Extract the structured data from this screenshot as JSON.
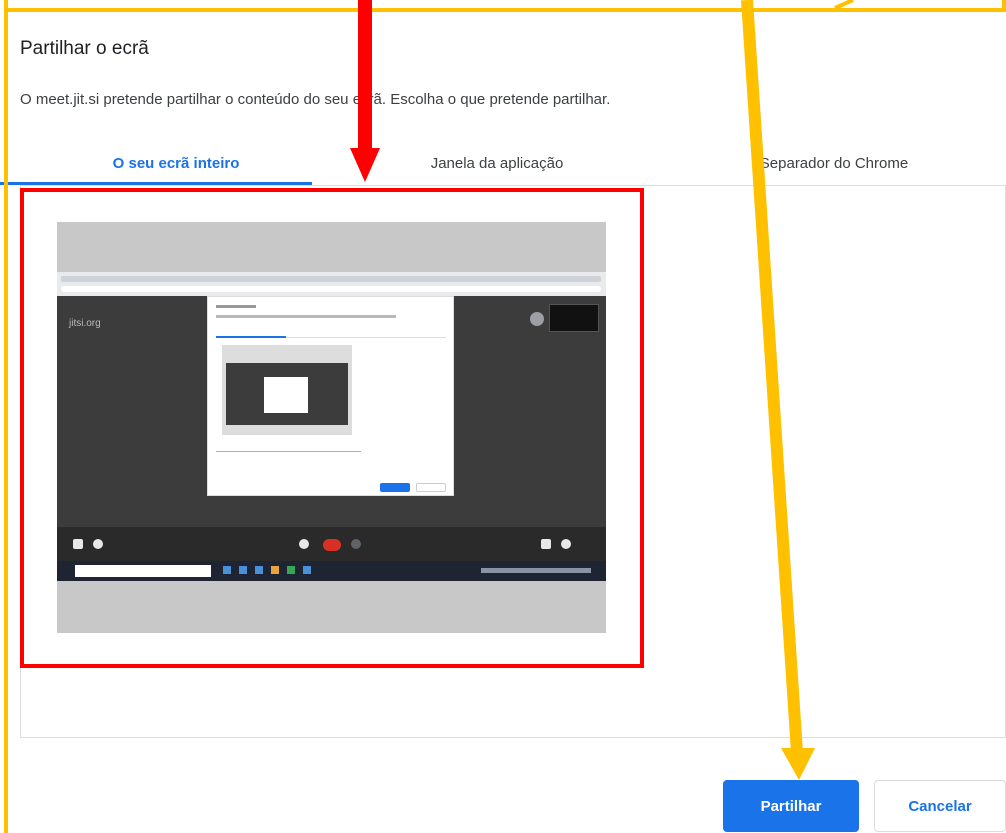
{
  "dialog": {
    "title": "Partilhar o ecrã",
    "description": "O meet.jit.si pretende partilhar o conteúdo do seu ecrã. Escolha o que pretende partilhar."
  },
  "tabs": [
    {
      "label": "O seu ecrã inteiro",
      "active": true
    },
    {
      "label": "Janela da aplicação",
      "active": false
    },
    {
      "label": "Separador do Chrome",
      "active": false
    }
  ],
  "preview": {
    "logo_text": "jitsi.org"
  },
  "buttons": {
    "share_label": "Partilhar",
    "cancel_label": "Cancelar"
  },
  "annotations": {
    "red_arrow_icon": "arrow-down-icon",
    "yellow_arrow_icon": "arrow-down-icon",
    "highlight_color": "#ff0000",
    "frame_color": "#ffc000"
  },
  "colors": {
    "accent": "#1a73e8"
  }
}
